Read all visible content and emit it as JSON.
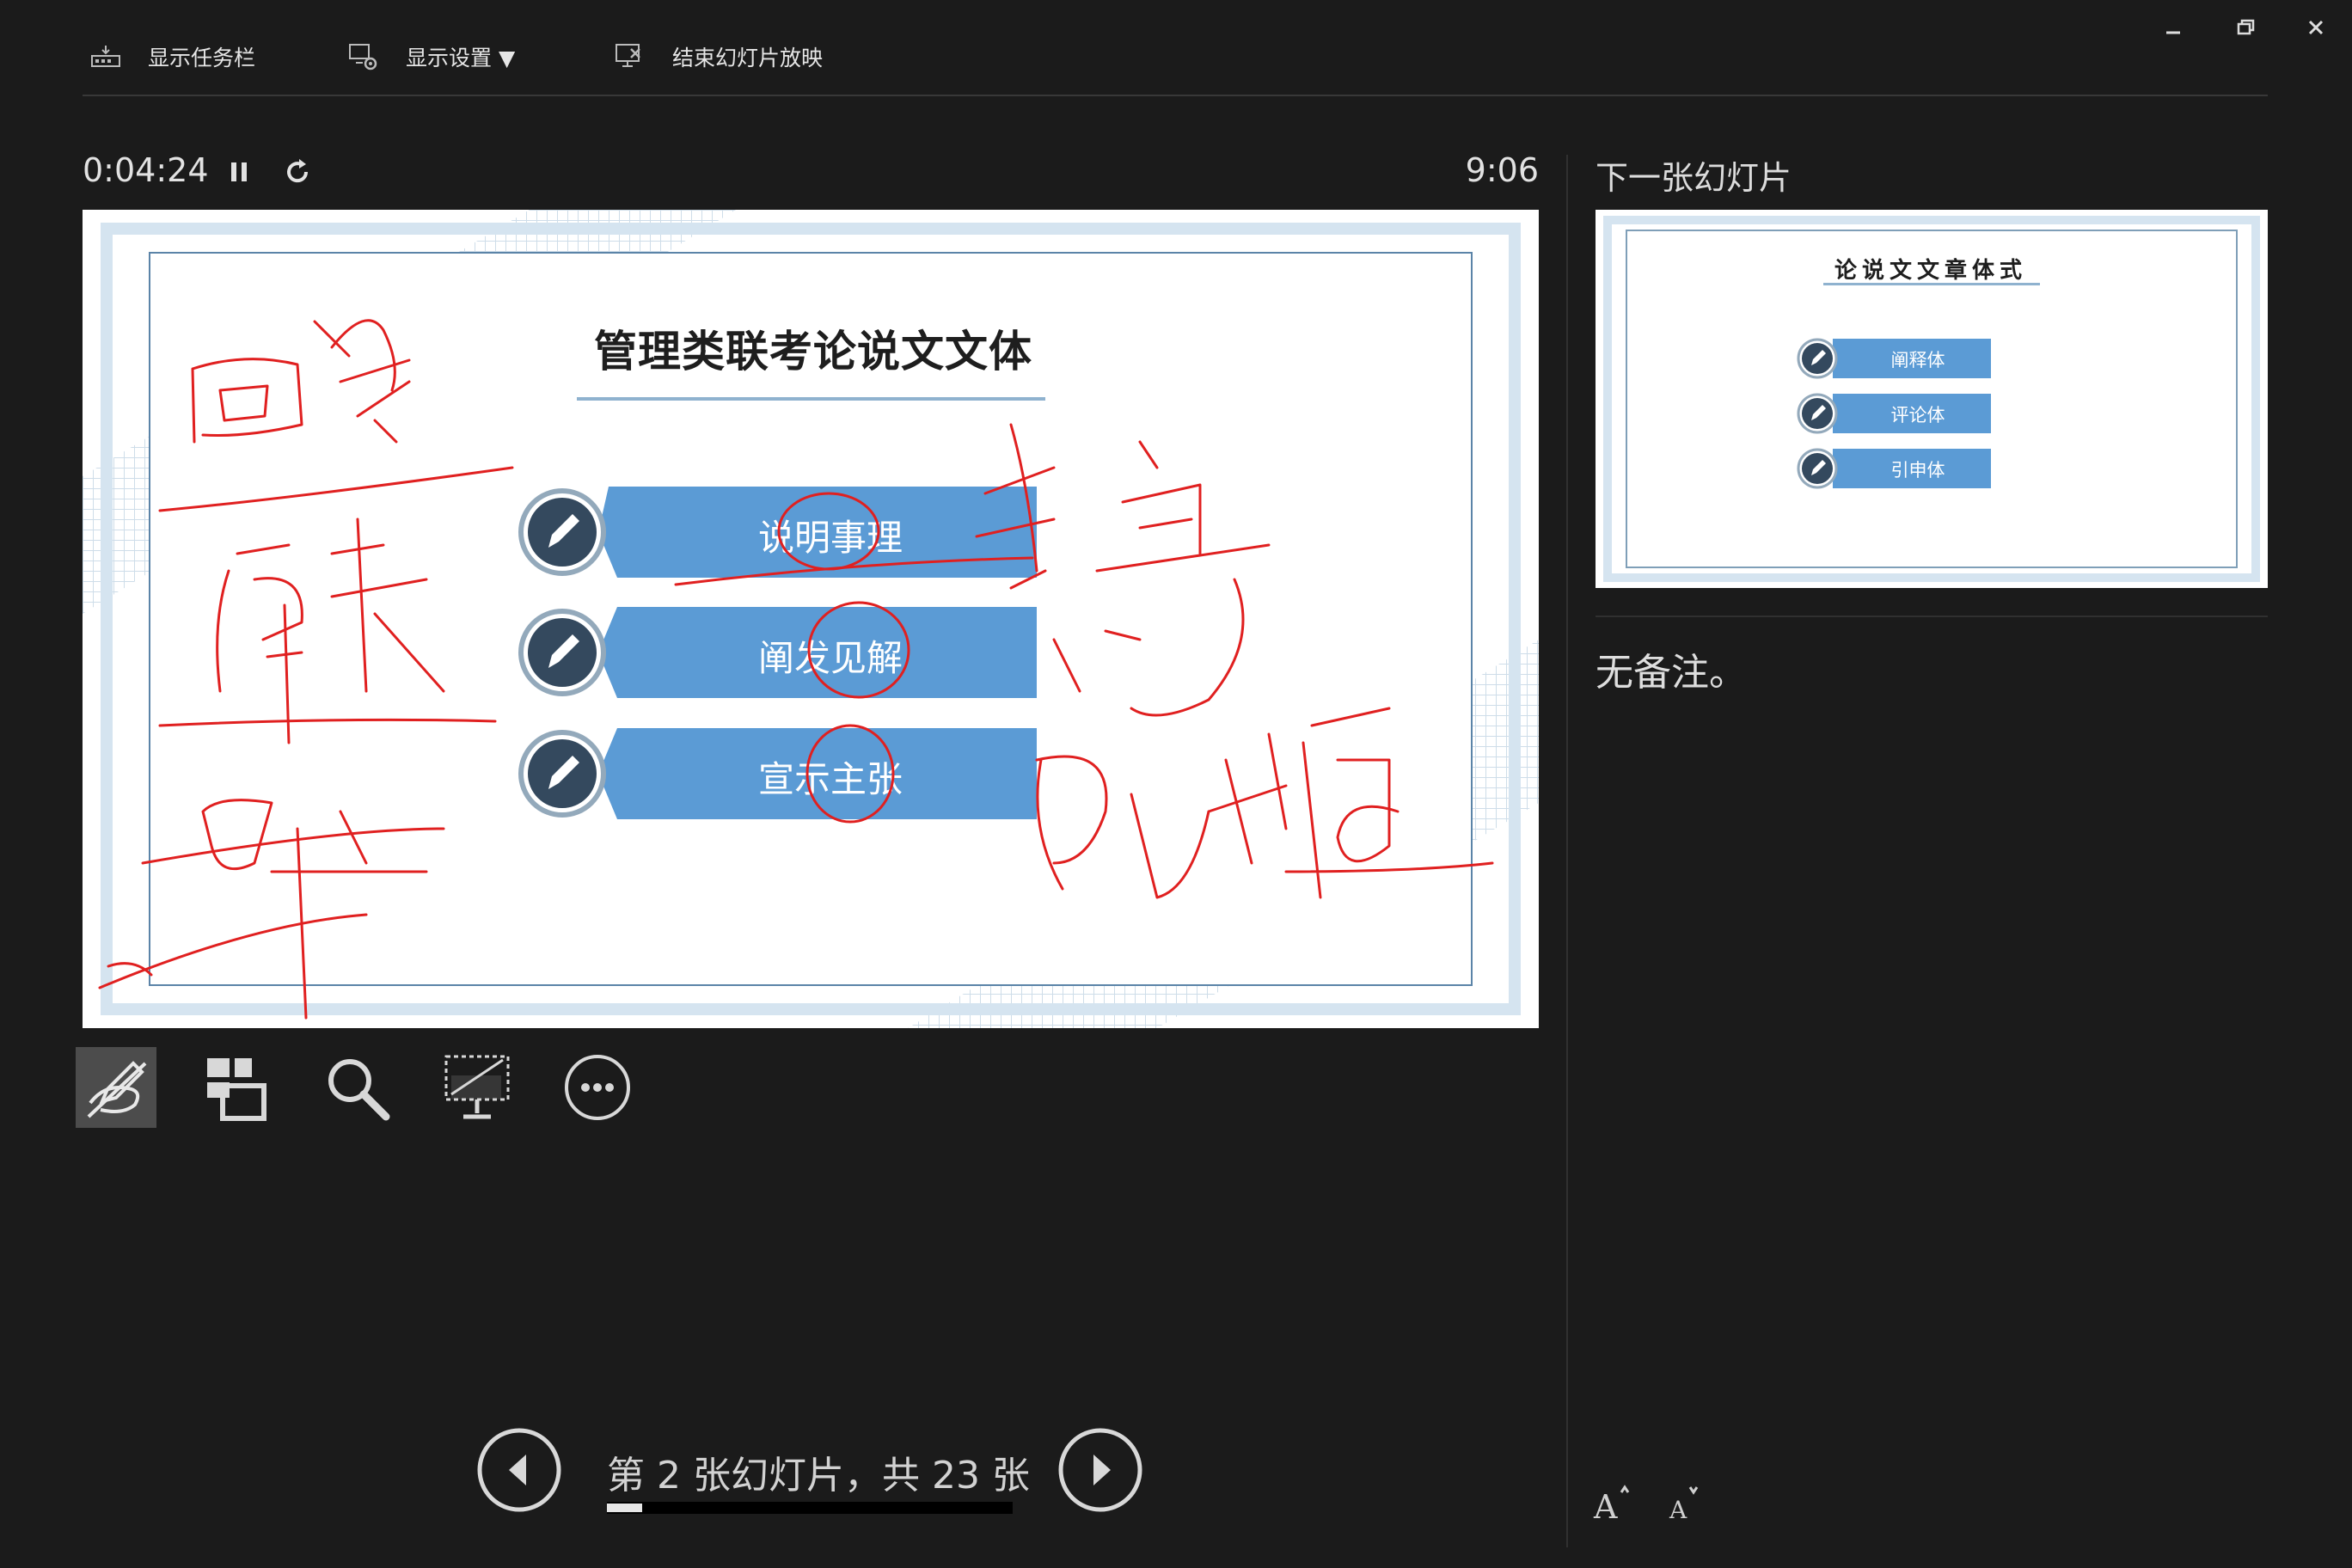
{
  "toolbar": {
    "show_taskbar": "显示任务栏",
    "display_settings": "显示设置 ▼",
    "end_slideshow": "结束幻灯片放映"
  },
  "timer": {
    "elapsed": "0:04:24",
    "clock": "9:06"
  },
  "slide": {
    "title": "管理类联考论说文文体",
    "items": [
      "说明事理",
      "阐发见解",
      "宣示主张"
    ]
  },
  "navigation": {
    "counter": "第 2 张幻灯片，共 23 张",
    "current": 2,
    "total": 23
  },
  "next_slide": {
    "label": "下一张幻灯片",
    "title": "论说文文章体式",
    "items": [
      "阐释体",
      "评论体",
      "引申体"
    ]
  },
  "notes": {
    "text": "无备注。"
  },
  "icons": {
    "toolbar": [
      "taskbar-icon",
      "display-settings-icon",
      "end-show-icon"
    ],
    "tools": [
      "pen-tools-icon",
      "see-all-slides-icon",
      "zoom-icon",
      "black-screen-icon",
      "more-options-icon"
    ],
    "window": [
      "minimize-icon",
      "restore-icon",
      "close-icon"
    ]
  },
  "colors": {
    "background": "#1b1b1b",
    "pill_blue": "#5b9bd5",
    "ink_red": "#e02020",
    "badge_dark": "#34495e"
  }
}
